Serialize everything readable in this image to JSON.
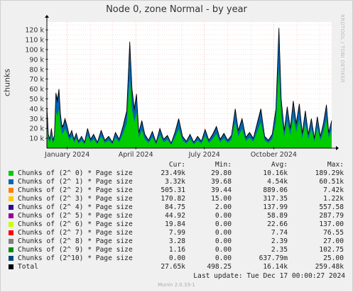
{
  "title": "Node 0, zone Normal - by year",
  "watermark": "RRDTOOL / TOBI OETIKER",
  "footer": "Munin 2.0.33-1",
  "last_update": "Last update:  Tue Dec 17 00:00:27 2024",
  "legend_headers": [
    "Cur:",
    "Min:",
    "Avg:",
    "Max:"
  ],
  "chart_data": {
    "type": "area",
    "title": "Node 0, zone Normal - by year",
    "ylabel": "chunks",
    "xlabel": "",
    "ylim": [
      0,
      128000
    ],
    "yticks": [
      10000,
      20000,
      30000,
      40000,
      50000,
      60000,
      70000,
      80000,
      90000,
      100000,
      110000,
      120000
    ],
    "ytick_labels": [
      "10 k",
      "20 k",
      "30 k",
      "40 k",
      "50 k",
      "60 k",
      "70 k",
      "80 k",
      "90 k",
      "100 k",
      "110 k",
      "120 k"
    ],
    "x_range": [
      "2023-12-05",
      "2024-12-17"
    ],
    "xticks": [
      {
        "date": "2024-01-01",
        "label": "January 2024"
      },
      {
        "date": "2024-04-01",
        "label": "April 2024"
      },
      {
        "date": "2024-07-01",
        "label": "July 2024"
      },
      {
        "date": "2024-10-01",
        "label": "October 2024"
      }
    ],
    "grid": true,
    "total_points": [
      [
        "2023-12-05",
        43000
      ],
      [
        "2023-12-07",
        14000
      ],
      [
        "2023-12-09",
        9000
      ],
      [
        "2023-12-11",
        20000
      ],
      [
        "2023-12-13",
        8000
      ],
      [
        "2023-12-15",
        13000
      ],
      [
        "2023-12-17",
        56000
      ],
      [
        "2023-12-19",
        49000
      ],
      [
        "2023-12-21",
        60000
      ],
      [
        "2023-12-23",
        35000
      ],
      [
        "2023-12-25",
        22000
      ],
      [
        "2023-12-27",
        24000
      ],
      [
        "2023-12-29",
        30000
      ],
      [
        "2024-01-01",
        22000
      ],
      [
        "2024-01-04",
        12000
      ],
      [
        "2024-01-07",
        18000
      ],
      [
        "2024-01-10",
        9000
      ],
      [
        "2024-01-13",
        15000
      ],
      [
        "2024-01-16",
        7000
      ],
      [
        "2024-01-20",
        12000
      ],
      [
        "2024-01-24",
        6000
      ],
      [
        "2024-01-28",
        20000
      ],
      [
        "2024-02-01",
        9000
      ],
      [
        "2024-02-05",
        14000
      ],
      [
        "2024-02-10",
        6000
      ],
      [
        "2024-02-15",
        18000
      ],
      [
        "2024-02-20",
        8000
      ],
      [
        "2024-02-25",
        12000
      ],
      [
        "2024-03-01",
        6000
      ],
      [
        "2024-03-05",
        16000
      ],
      [
        "2024-03-10",
        9000
      ],
      [
        "2024-03-15",
        22000
      ],
      [
        "2024-03-20",
        38000
      ],
      [
        "2024-03-24",
        108000
      ],
      [
        "2024-03-27",
        60000
      ],
      [
        "2024-03-30",
        40000
      ],
      [
        "2024-04-02",
        55000
      ],
      [
        "2024-04-05",
        16000
      ],
      [
        "2024-04-09",
        28000
      ],
      [
        "2024-04-13",
        14000
      ],
      [
        "2024-04-18",
        8000
      ],
      [
        "2024-04-23",
        17000
      ],
      [
        "2024-04-28",
        6000
      ],
      [
        "2024-05-03",
        20000
      ],
      [
        "2024-05-08",
        9000
      ],
      [
        "2024-05-13",
        13000
      ],
      [
        "2024-05-18",
        5000
      ],
      [
        "2024-05-23",
        16000
      ],
      [
        "2024-05-28",
        30000
      ],
      [
        "2024-06-02",
        12000
      ],
      [
        "2024-06-07",
        7000
      ],
      [
        "2024-06-12",
        14000
      ],
      [
        "2024-06-17",
        6000
      ],
      [
        "2024-06-22",
        12000
      ],
      [
        "2024-06-27",
        7000
      ],
      [
        "2024-07-02",
        19000
      ],
      [
        "2024-07-07",
        8000
      ],
      [
        "2024-07-12",
        14000
      ],
      [
        "2024-07-17",
        22000
      ],
      [
        "2024-07-22",
        9000
      ],
      [
        "2024-07-27",
        15000
      ],
      [
        "2024-08-01",
        8000
      ],
      [
        "2024-08-06",
        13000
      ],
      [
        "2024-08-11",
        40000
      ],
      [
        "2024-08-15",
        18000
      ],
      [
        "2024-08-20",
        30000
      ],
      [
        "2024-08-25",
        11000
      ],
      [
        "2024-08-30",
        16000
      ],
      [
        "2024-09-04",
        10000
      ],
      [
        "2024-09-09",
        25000
      ],
      [
        "2024-09-14",
        40000
      ],
      [
        "2024-09-19",
        12000
      ],
      [
        "2024-09-24",
        8000
      ],
      [
        "2024-09-29",
        14000
      ],
      [
        "2024-10-04",
        40000
      ],
      [
        "2024-10-08",
        122000
      ],
      [
        "2024-10-11",
        50000
      ],
      [
        "2024-10-15",
        18000
      ],
      [
        "2024-10-19",
        42000
      ],
      [
        "2024-10-23",
        20000
      ],
      [
        "2024-10-27",
        48000
      ],
      [
        "2024-10-31",
        25000
      ],
      [
        "2024-11-04",
        45000
      ],
      [
        "2024-11-08",
        15000
      ],
      [
        "2024-11-12",
        38000
      ],
      [
        "2024-11-16",
        14000
      ],
      [
        "2024-11-20",
        30000
      ],
      [
        "2024-11-24",
        10000
      ],
      [
        "2024-11-28",
        32000
      ],
      [
        "2024-12-02",
        12000
      ],
      [
        "2024-12-06",
        25000
      ],
      [
        "2024-12-10",
        44000
      ],
      [
        "2024-12-13",
        16000
      ],
      [
        "2024-12-17",
        28000
      ]
    ],
    "series": [
      {
        "name": "Chunks of (2^ 0) * Page size",
        "color": "#00cc00",
        "cur": "23.49k",
        "min": "29.80",
        "avg": "10.16k",
        "max": "189.29k"
      },
      {
        "name": "Chunks of (2^ 1) * Page size",
        "color": "#0066b3",
        "cur": "3.32k",
        "min": "39.68",
        "avg": "4.54k",
        "max": "60.51k"
      },
      {
        "name": "Chunks of (2^ 2) * Page size",
        "color": "#ff8000",
        "cur": "505.31",
        "min": "39.44",
        "avg": "889.06",
        "max": "7.42k"
      },
      {
        "name": "Chunks of (2^ 3) * Page size",
        "color": "#ffcc00",
        "cur": "170.82",
        "min": "15.00",
        "avg": "317.35",
        "max": "1.22k"
      },
      {
        "name": "Chunks of (2^ 4) * Page size",
        "color": "#330099",
        "cur": "84.75",
        "min": "2.00",
        "avg": "137.99",
        "max": "557.58"
      },
      {
        "name": "Chunks of (2^ 5) * Page size",
        "color": "#990099",
        "cur": "44.92",
        "min": "0.00",
        "avg": "58.89",
        "max": "287.79"
      },
      {
        "name": "Chunks of (2^ 6) * Page size",
        "color": "#ccff00",
        "cur": "19.84",
        "min": "0.00",
        "avg": "22.66",
        "max": "137.00"
      },
      {
        "name": "Chunks of (2^ 7) * Page size",
        "color": "#ff0000",
        "cur": "7.99",
        "min": "0.00",
        "avg": "7.74",
        "max": "76.55"
      },
      {
        "name": "Chunks of (2^ 8) * Page size",
        "color": "#808080",
        "cur": "3.28",
        "min": "0.00",
        "avg": "2.39",
        "max": "27.00"
      },
      {
        "name": "Chunks of (2^ 9) * Page size",
        "color": "#008f00",
        "cur": "1.16",
        "min": "0.00",
        "avg": "2.35",
        "max": "102.75"
      },
      {
        "name": "Chunks of (2^10) * Page size",
        "color": "#00487d",
        "cur": "0.00",
        "min": "0.00",
        "avg": "637.79m",
        "max": "25.00"
      },
      {
        "name": "Total",
        "color": "#000000",
        "cur": "27.65k",
        "min": "498.25",
        "avg": "16.14k",
        "max": "259.48k"
      }
    ]
  }
}
